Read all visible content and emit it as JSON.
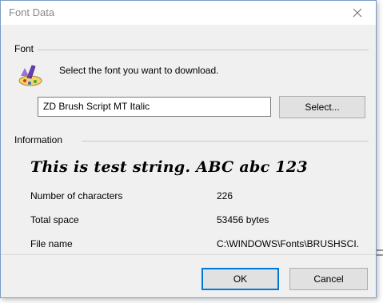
{
  "window": {
    "title": "Font Data"
  },
  "font_section": {
    "label": "Font",
    "prompt": "Select the font you want to download.",
    "font_value": "ZD Brush Script MT Italic",
    "select_button": "Select..."
  },
  "info_section": {
    "label": "Information",
    "sample_text": "This is test string. ABC abc 123",
    "rows": [
      {
        "label": "Number of characters",
        "value": "226"
      },
      {
        "label": "Total space",
        "value": "53456 bytes"
      },
      {
        "label": "File name",
        "value": "C:\\WINDOWS\\Fonts\\BRUSHSCI."
      }
    ]
  },
  "buttons": {
    "ok": "OK",
    "cancel": "Cancel"
  },
  "icons": {
    "app": "font-paint-icon",
    "close": "close-icon"
  },
  "colors": {
    "accent": "#0078d7",
    "dialog_bg": "#f0f0f0"
  }
}
